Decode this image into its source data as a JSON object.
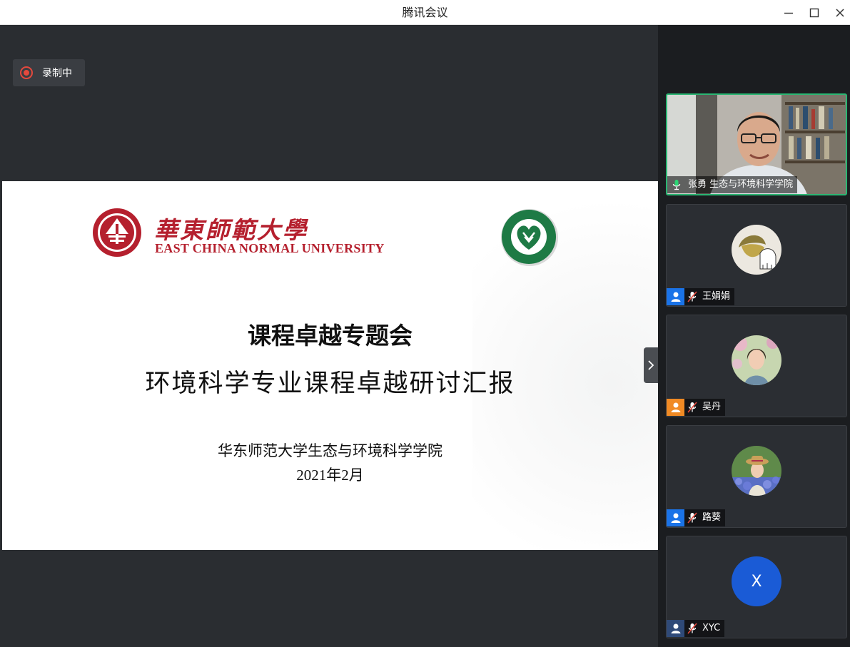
{
  "window": {
    "title": "腾讯会议",
    "controls": [
      "minimize-icon",
      "maximize-icon",
      "close-icon"
    ]
  },
  "recording": {
    "label": "录制中",
    "icon": "record-icon",
    "color": "#e5493d"
  },
  "slide": {
    "university_cn": "華東師範大學",
    "university_en": "EAST CHINA NORMAL UNIVERSITY",
    "title": "课程卓越专题会",
    "subtitle": "环境科学专业课程卓越研讨汇报",
    "organization": "华东师范大学生态与环境科学学院",
    "date": "2021年2月",
    "brand_color": "#b5202e",
    "college_logo_color": "#1e7a45"
  },
  "panel_toggle": {
    "icon": "chevron-right-icon"
  },
  "participants": [
    {
      "name": "张勇 生态与环境科学学院",
      "mic": "mic-on-icon",
      "video": true,
      "speaking": true,
      "accent": "#2bb673"
    },
    {
      "name": "王娟娟",
      "mic": "mic-muted-icon",
      "user_icon_color": "#1a73e8"
    },
    {
      "name": "吴丹",
      "mic": "mic-muted-icon",
      "user_icon_color": "#f08a24"
    },
    {
      "name": "路葵",
      "mic": "mic-muted-icon",
      "user_icon_color": "#1a73e8"
    },
    {
      "name": "XYC",
      "mic": "mic-muted-icon",
      "avatar_letter": "X",
      "avatar_color": "#1a5bd6",
      "user_icon_color": "#2f4a78"
    }
  ]
}
